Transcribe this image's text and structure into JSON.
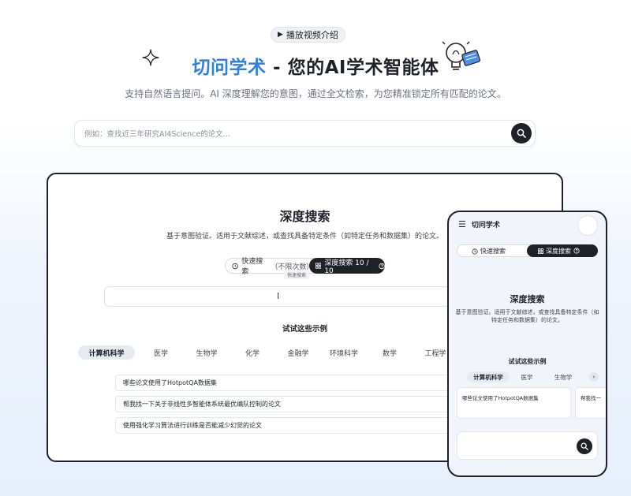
{
  "hero": {
    "video_label": "播放视频介绍",
    "title_brand": "切问学术",
    "title_rest": " - 您的AI学术智能体",
    "subtitle": "支持自然语言提问。AI 深度理解您的意图，通过全文检索，为您精准锁定所有匹配的论文。",
    "search_placeholder": "例如：查找近三年研究AI4Science的论文..."
  },
  "desktop": {
    "title": "深度搜索",
    "subtitle": "基于意图验证。适用于文献综述，或查找具备特定条件（如特定任务和数据集）的论文。",
    "quick_label": "快速搜索",
    "quick_sub": "（不限次数）",
    "deep_label": "深度搜索 10 / 10",
    "tooltip": "快速搜索",
    "cursor": "I",
    "examples_title": "试试这些示例",
    "tabs": [
      "计算机科学",
      "医学",
      "生物学",
      "化学",
      "金融学",
      "环境科学",
      "数学",
      "工程学"
    ],
    "examples": [
      "哪些论文使用了HotpotQA数据集",
      "帮我找一下关于非线性多智能体系统最优编队控制的论文",
      "使用强化学习算法进行训练是否能减少幻觉的论文"
    ]
  },
  "phone": {
    "app_title": "切问学术",
    "quick_label": "快速搜索",
    "deep_label": "深度搜索",
    "title": "深度搜索",
    "subtitle": "基于意图验证。适用于文献综述，或查找具备特定条件（如特定任务和数据集）的论文。",
    "examples_title": "试试这些示例",
    "tabs": [
      "计算机科学",
      "医学",
      "生物学"
    ],
    "more_arrow": "›",
    "cards": [
      "哪些论文使用了HotpotQA数据集",
      "帮我找一"
    ]
  }
}
